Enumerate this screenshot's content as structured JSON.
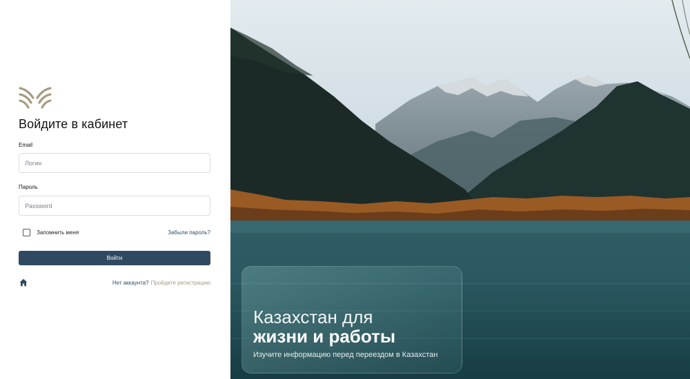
{
  "login": {
    "title": "Войдите в кабинет",
    "email_label": "Email",
    "email_placeholder": "Логин",
    "password_label": "Пароль",
    "password_placeholder": "Password",
    "remember_label": "Запомнить меня",
    "remember_checked": false,
    "forgot_label": "Забыли пароль?",
    "submit_label": "Войти",
    "no_account_text": "Нет аккаунта?",
    "register_link": "Пройдите регистрацию",
    "home_icon": "home-icon",
    "logo_icon": "wings-logo-icon"
  },
  "promo": {
    "line1": "Казахстан для",
    "line2": "жизни и работы",
    "subtitle": "Изучите информацию перед переездом в Казахстан"
  },
  "colors": {
    "primary_button": "#2f4a60",
    "link": "#2b4d66",
    "register_link": "#a39985",
    "logo": "#a89a80"
  }
}
